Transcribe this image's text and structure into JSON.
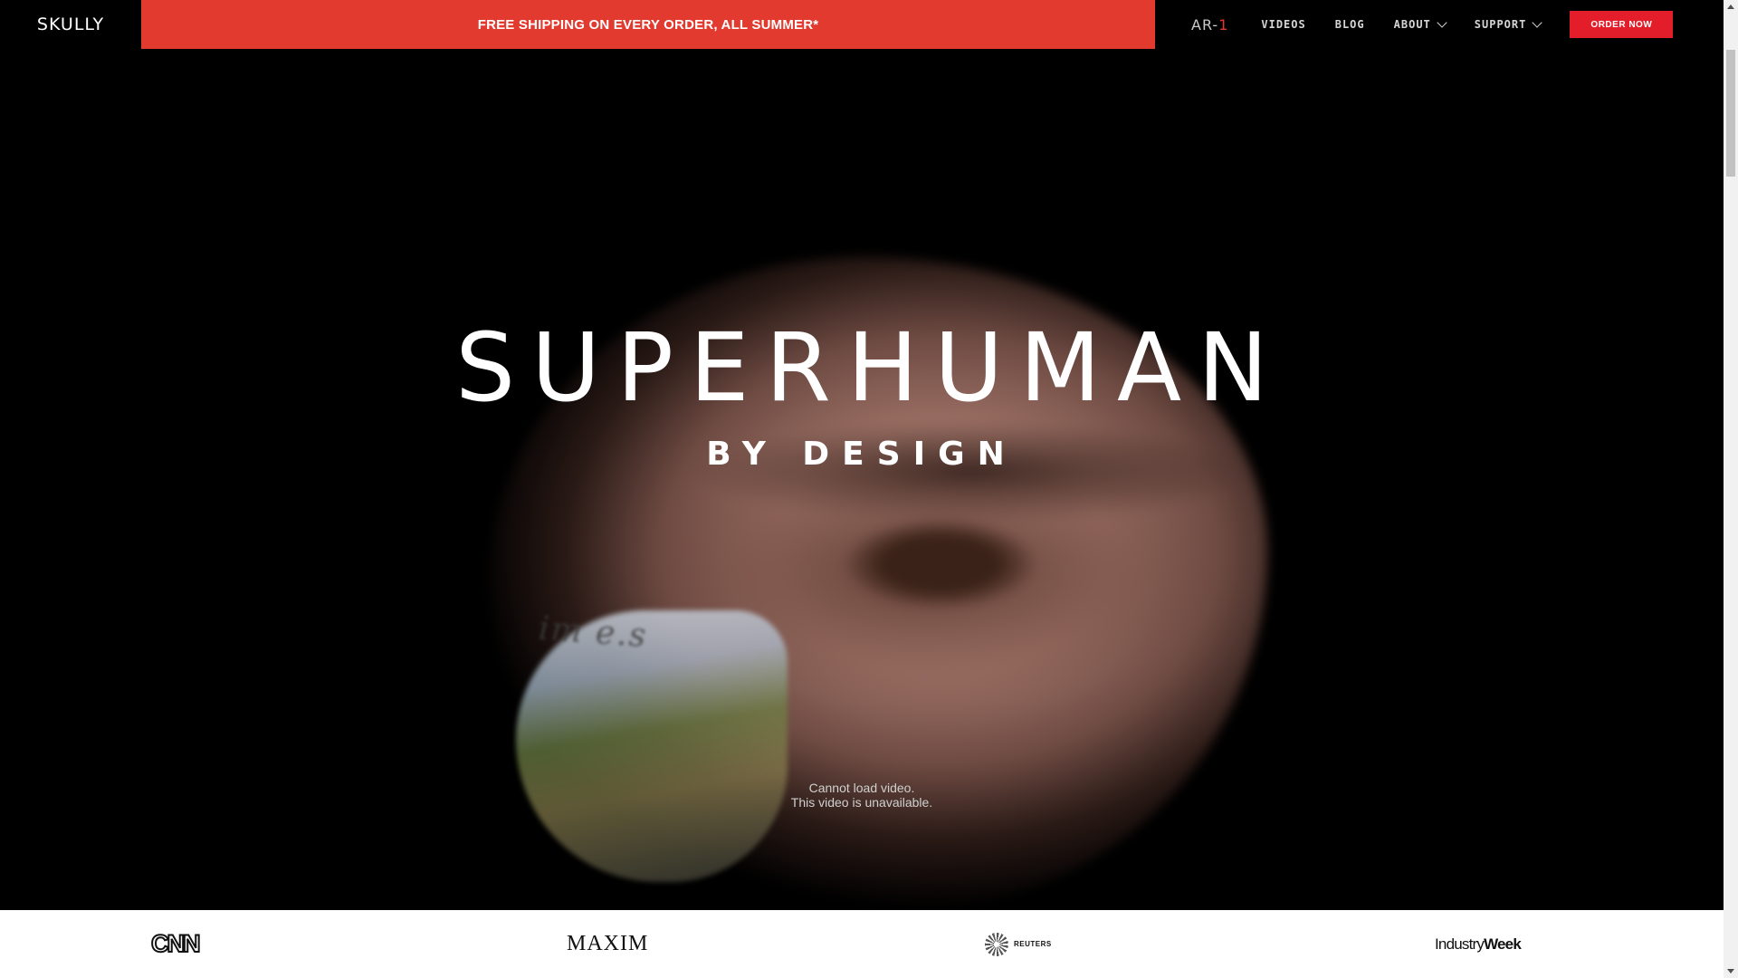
{
  "header": {
    "logo": "SKULLY",
    "promo": "FREE SHIPPING ON EVERY ORDER, ALL SUMMER*",
    "nav": {
      "ar1_prefix": "AR-",
      "ar1_suffix": "1",
      "videos": "VIDEOS",
      "blog": "BLOG",
      "about": "ABOUT",
      "support": "SUPPORT"
    },
    "order_button": "ORDER NOW"
  },
  "hero": {
    "title": "SUPERHUMAN",
    "subtitle": "BY DESIGN",
    "video_error_line1": "Cannot load video.",
    "video_error_line2": "This video is unavailable.",
    "screen_text": "im e.s"
  },
  "press": {
    "logos": [
      "CNN",
      "MAXIM",
      "REUTERS",
      "IndustryWeek"
    ],
    "industryweek_part1": "Industry",
    "industryweek_part2": "Week"
  },
  "colors": {
    "promo_bg": "#e23a2e",
    "button_bg": "#e31e2a",
    "accent": "#e23a2e"
  }
}
